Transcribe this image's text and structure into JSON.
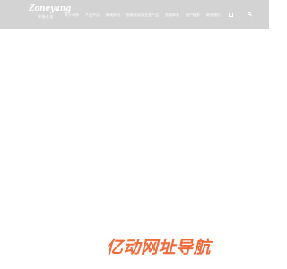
{
  "brand": {
    "name_en": "Zoneyang",
    "name_cn": "卓扬五金"
  },
  "nav": {
    "items": [
      {
        "label": "关于卓扬"
      },
      {
        "label": "产品中心"
      },
      {
        "label": "新闻资讯"
      },
      {
        "label": "智能家居及五金产品"
      },
      {
        "label": "质量体系"
      },
      {
        "label": "客户服务"
      },
      {
        "label": "联系我们"
      }
    ]
  },
  "header": {
    "icons": [
      "language-icon",
      "search-icon"
    ]
  },
  "watermark": {
    "text": "亿动网址导航"
  },
  "colors": {
    "header_bg": "#d3d3d3",
    "page_bg": "#ffffff",
    "watermark": "#f06a3a"
  }
}
